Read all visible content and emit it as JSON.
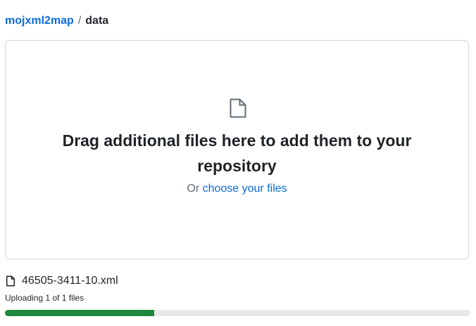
{
  "breadcrumb": {
    "repo": "mojxml2map",
    "separator": "/",
    "folder": "data"
  },
  "dropzone": {
    "icon": "file-icon",
    "heading": "Drag additional files here to add them to your repository",
    "sub_prefix": "Or",
    "choose_link": "choose your files"
  },
  "upload": {
    "icon": "file-icon",
    "filename": "46505-3411-10.xml",
    "status": "Uploading 1 of 1 files",
    "progress": 0.32,
    "progress_color": "#1f883d",
    "track_color": "#e8e8e8"
  },
  "colors": {
    "link": "#0969da",
    "text": "#1f2328",
    "muted": "#636c76",
    "border": "#d0d7de"
  }
}
